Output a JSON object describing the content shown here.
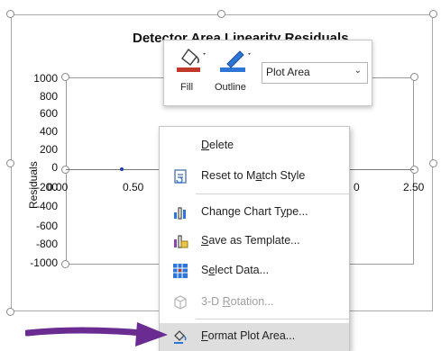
{
  "chart": {
    "title": "Detector Area Linearity Residuals",
    "y_axis_title": "Residuals",
    "y_ticks": [
      "1000",
      "800",
      "600",
      "400",
      "200",
      "0",
      "-200",
      "-400",
      "-600",
      "-800",
      "-1000"
    ],
    "x_ticks_visible": [
      "0.00",
      "0.50",
      "0",
      "2.50"
    ]
  },
  "mini_toolbar": {
    "fill_label": "Fill",
    "outline_label": "Outline",
    "element_select_value": "Plot Area",
    "fill_color": "#c0392b",
    "outline_color": "#2e75d6"
  },
  "context_menu": {
    "items": [
      {
        "pre": "",
        "acc": "D",
        "post": "elete",
        "icon": "none",
        "enabled": true
      },
      {
        "pre": "Reset to M",
        "acc": "a",
        "post": "tch Style",
        "icon": "reset-style-icon",
        "enabled": true
      },
      {
        "pre": "Change Chart T",
        "acc": "y",
        "post": "pe...",
        "icon": "change-chart-type-icon",
        "enabled": true
      },
      {
        "pre": "",
        "acc": "S",
        "post": "ave as Template...",
        "icon": "save-template-icon",
        "enabled": true
      },
      {
        "pre": "S",
        "acc": "e",
        "post": "lect Data...",
        "icon": "select-data-icon",
        "enabled": true
      },
      {
        "pre": "3-D ",
        "acc": "R",
        "post": "otation...",
        "icon": "3d-rotation-icon",
        "enabled": false
      },
      {
        "pre": "",
        "acc": "F",
        "post": "ormat Plot Area...",
        "icon": "format-plot-area-icon",
        "enabled": true
      }
    ]
  },
  "colors": {
    "arrow": "#6a2c91",
    "hover": "#dedede"
  }
}
